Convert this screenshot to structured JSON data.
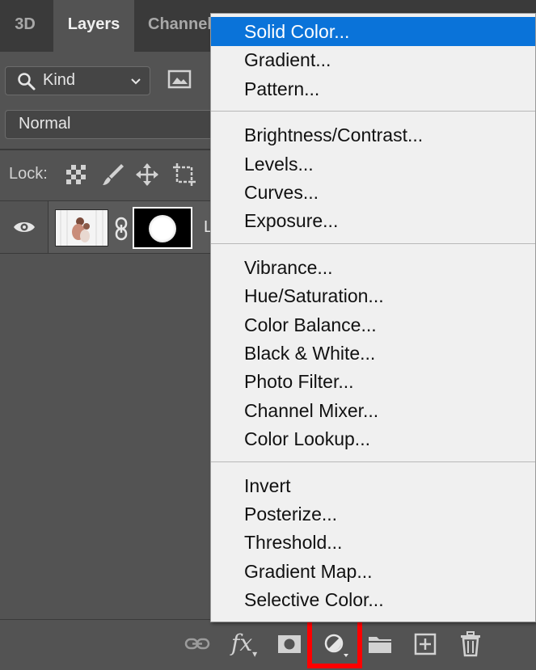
{
  "tabs": [
    {
      "label": "3D",
      "active": false
    },
    {
      "label": "Layers",
      "active": true
    },
    {
      "label": "Channels",
      "active": false
    }
  ],
  "filter": {
    "kind_label": "Kind",
    "icons": [
      "search-icon",
      "image-filter-icon",
      "chevron-down-icon"
    ]
  },
  "blend_mode": "Normal",
  "lock": {
    "label": "Lock:",
    "icons": [
      "lock-transparent-pixels-icon",
      "lock-image-pixels-icon",
      "lock-position-icon",
      "lock-artboard-icon"
    ]
  },
  "layer": {
    "visible": true,
    "name": "L"
  },
  "menu": {
    "selected": "Solid Color...",
    "groups": [
      [
        "Solid Color...",
        "Gradient...",
        "Pattern..."
      ],
      [
        "Brightness/Contrast...",
        "Levels...",
        "Curves...",
        "Exposure..."
      ],
      [
        "Vibrance...",
        "Hue/Saturation...",
        "Color Balance...",
        "Black & White...",
        "Photo Filter...",
        "Channel Mixer...",
        "Color Lookup..."
      ],
      [
        "Invert",
        "Posterize...",
        "Threshold...",
        "Gradient Map...",
        "Selective Color..."
      ]
    ]
  },
  "footer": {
    "buttons": [
      "link-layers-icon",
      "fx-icon",
      "add-mask-icon",
      "adjustment-layer-icon",
      "group-folder-icon",
      "new-layer-icon",
      "trash-icon"
    ],
    "fx_label": "fx",
    "highlighted": "adjustment-layer-icon",
    "highlight_color": "#ff0000"
  },
  "colors": {
    "panel": "#535353",
    "selected": "#0a73d9",
    "menu_bg": "#f0f0f0"
  }
}
